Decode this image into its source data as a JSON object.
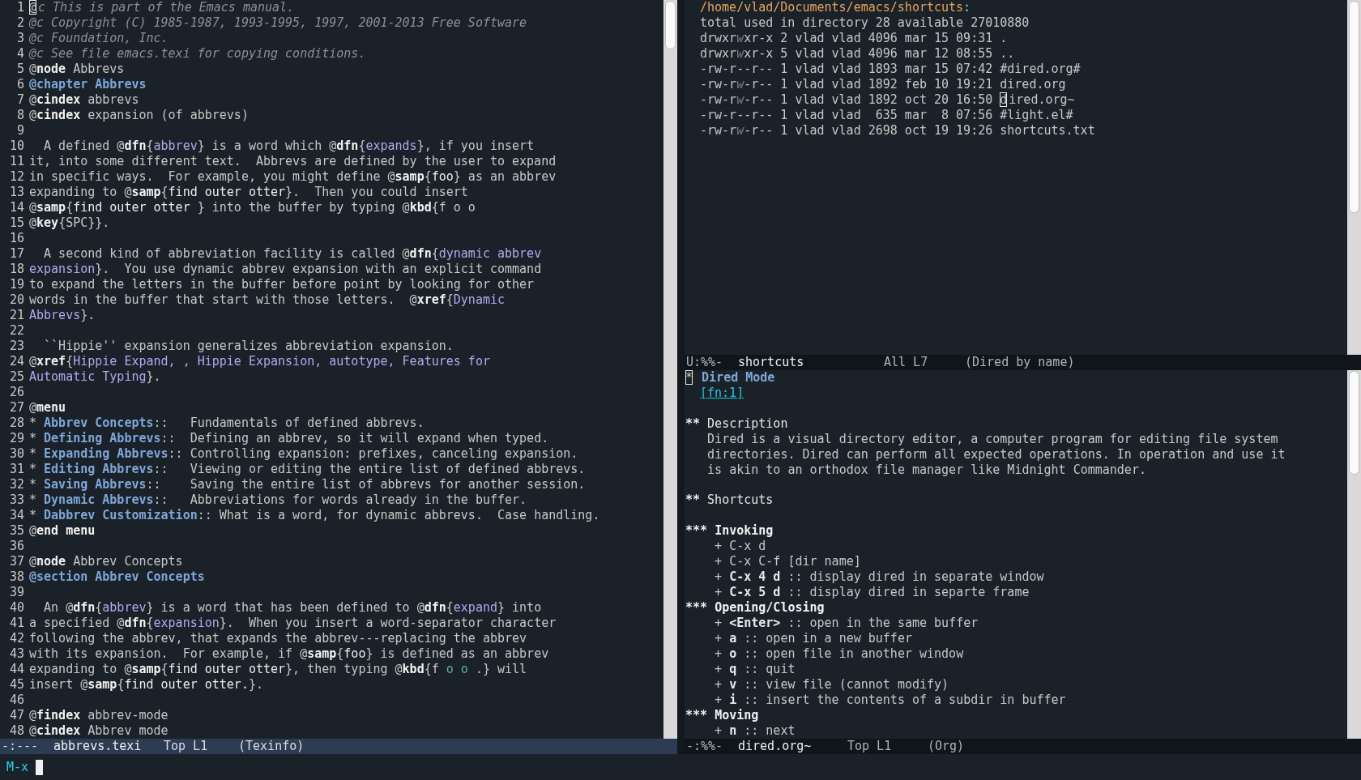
{
  "texinfo_window": {
    "lines": [
      {
        "number": "1",
        "segments": [
          {
            "text": "@",
            "kind": "cursor"
          },
          {
            "text": "c This is part of the Emacs manual.",
            "kind": "comment"
          }
        ]
      },
      {
        "number": "2",
        "segments": [
          {
            "text": "@c Copyright (C) 1985-1987, 1993-1995, 1997, 2001-2013 Free Software",
            "kind": "comment"
          }
        ]
      },
      {
        "number": "3",
        "segments": [
          {
            "text": "@c Foundation, Inc.",
            "kind": "comment"
          }
        ]
      },
      {
        "number": "4",
        "segments": [
          {
            "text": "@c See file emacs.texi for copying conditions.",
            "kind": "comment"
          }
        ]
      },
      {
        "number": "5",
        "segments": [
          {
            "text": "@",
            "kind": "text"
          },
          {
            "text": "node",
            "kind": "command"
          },
          {
            "text": " Abbrevs",
            "kind": "text"
          }
        ]
      },
      {
        "number": "6",
        "segments": [
          {
            "text": "@chapter Abbrevs",
            "kind": "heading"
          }
        ]
      },
      {
        "number": "7",
        "segments": [
          {
            "text": "@",
            "kind": "text"
          },
          {
            "text": "cindex",
            "kind": "command"
          },
          {
            "text": " abbrevs",
            "kind": "text"
          }
        ]
      },
      {
        "number": "8",
        "segments": [
          {
            "text": "@",
            "kind": "text"
          },
          {
            "text": "cindex",
            "kind": "command"
          },
          {
            "text": " expansion (of abbrevs)",
            "kind": "text"
          }
        ]
      },
      {
        "number": "9",
        "kind": "blank"
      },
      {
        "number": "10",
        "segments": [
          {
            "text": "  A defined @",
            "kind": "text"
          },
          {
            "text": "dfn",
            "kind": "command"
          },
          {
            "text": "{",
            "kind": "text"
          },
          {
            "text": "abbrev",
            "kind": "arg"
          },
          {
            "text": "} is a word which @",
            "kind": "text"
          },
          {
            "text": "dfn",
            "kind": "command"
          },
          {
            "text": "{",
            "kind": "text"
          },
          {
            "text": "expands",
            "kind": "arg"
          },
          {
            "text": "}, if you insert",
            "kind": "text"
          }
        ]
      },
      {
        "number": "11",
        "segments": [
          {
            "text": "it, into some different text.  Abbrevs are defined by the user to expand",
            "kind": "text"
          }
        ]
      },
      {
        "number": "12",
        "segments": [
          {
            "text": "in specific ways.  For example, you might define @",
            "kind": "text"
          },
          {
            "text": "samp",
            "kind": "command"
          },
          {
            "text": "{",
            "kind": "text"
          },
          {
            "text": "foo",
            "kind": "literal"
          },
          {
            "text": "} as an abbrev",
            "kind": "text"
          }
        ]
      },
      {
        "number": "13",
        "segments": [
          {
            "text": "expanding to @",
            "kind": "text"
          },
          {
            "text": "samp",
            "kind": "command"
          },
          {
            "text": "{",
            "kind": "text"
          },
          {
            "text": "find outer otter",
            "kind": "literal"
          },
          {
            "text": "}.  Then you could insert",
            "kind": "text"
          }
        ]
      },
      {
        "number": "14",
        "segments": [
          {
            "text": "@",
            "kind": "text"
          },
          {
            "text": "samp",
            "kind": "command"
          },
          {
            "text": "{",
            "kind": "text"
          },
          {
            "text": "find outer otter ",
            "kind": "literal"
          },
          {
            "text": "} into the buffer by typing @",
            "kind": "text"
          },
          {
            "text": "kbd",
            "kind": "command"
          },
          {
            "text": "{f o o",
            "kind": "text"
          }
        ]
      },
      {
        "number": "15",
        "segments": [
          {
            "text": "@",
            "kind": "text"
          },
          {
            "text": "key",
            "kind": "command"
          },
          {
            "text": "{SPC}}.",
            "kind": "text"
          }
        ]
      },
      {
        "number": "16",
        "kind": "blank"
      },
      {
        "number": "17",
        "segments": [
          {
            "text": "  A second kind of abbreviation facility is called @",
            "kind": "text"
          },
          {
            "text": "dfn",
            "kind": "command"
          },
          {
            "text": "{",
            "kind": "text"
          },
          {
            "text": "dynamic abbrev",
            "kind": "arg"
          }
        ]
      },
      {
        "number": "18",
        "segments": [
          {
            "text": "expansion",
            "kind": "arg"
          },
          {
            "text": "}.  You use dynamic abbrev expansion with an explicit command",
            "kind": "text"
          }
        ]
      },
      {
        "number": "19",
        "segments": [
          {
            "text": "to expand the letters in the buffer before point by looking for other",
            "kind": "text"
          }
        ]
      },
      {
        "number": "20",
        "segments": [
          {
            "text": "words in the buffer that start with those letters.  @",
            "kind": "text"
          },
          {
            "text": "xref",
            "kind": "command"
          },
          {
            "text": "{",
            "kind": "text"
          },
          {
            "text": "Dynamic",
            "kind": "arg"
          }
        ]
      },
      {
        "number": "21",
        "segments": [
          {
            "text": "Abbrevs",
            "kind": "arg"
          },
          {
            "text": "}.",
            "kind": "text"
          }
        ]
      },
      {
        "number": "22",
        "kind": "blank"
      },
      {
        "number": "23",
        "segments": [
          {
            "text": "  ``Hippie'' expansion generalizes abbreviation expansion.",
            "kind": "text"
          }
        ]
      },
      {
        "number": "24",
        "segments": [
          {
            "text": "@",
            "kind": "text"
          },
          {
            "text": "xref",
            "kind": "command"
          },
          {
            "text": "{",
            "kind": "text"
          },
          {
            "text": "Hippie Expand, , Hippie Expansion, autotype, Features for",
            "kind": "arg"
          }
        ]
      },
      {
        "number": "25",
        "segments": [
          {
            "text": "Automatic Typing",
            "kind": "arg"
          },
          {
            "text": "}.",
            "kind": "text"
          }
        ]
      },
      {
        "number": "26",
        "kind": "blank"
      },
      {
        "number": "27",
        "segments": [
          {
            "text": "@",
            "kind": "text"
          },
          {
            "text": "menu",
            "kind": "command"
          }
        ]
      },
      {
        "number": "28",
        "segments": [
          {
            "text": "* ",
            "kind": "text"
          },
          {
            "text": "Abbrev Concepts",
            "kind": "heading"
          },
          {
            "text": "::   Fundamentals of defined abbrevs.",
            "kind": "text"
          }
        ]
      },
      {
        "number": "29",
        "segments": [
          {
            "text": "* ",
            "kind": "text"
          },
          {
            "text": "Defining Abbrevs",
            "kind": "heading"
          },
          {
            "text": "::  Defining an abbrev, so it will expand when typed.",
            "kind": "text"
          }
        ]
      },
      {
        "number": "30",
        "segments": [
          {
            "text": "* ",
            "kind": "text"
          },
          {
            "text": "Expanding Abbrevs",
            "kind": "heading"
          },
          {
            "text": ":: Controlling expansion: prefixes, canceling expansion.",
            "kind": "text"
          }
        ]
      },
      {
        "number": "31",
        "segments": [
          {
            "text": "* ",
            "kind": "text"
          },
          {
            "text": "Editing Abbrevs",
            "kind": "heading"
          },
          {
            "text": "::   Viewing or editing the entire list of defined abbrevs.",
            "kind": "text"
          }
        ]
      },
      {
        "number": "32",
        "segments": [
          {
            "text": "* ",
            "kind": "text"
          },
          {
            "text": "Saving Abbrevs",
            "kind": "heading"
          },
          {
            "text": "::    Saving the entire list of abbrevs for another session.",
            "kind": "text"
          }
        ]
      },
      {
        "number": "33",
        "segments": [
          {
            "text": "* ",
            "kind": "text"
          },
          {
            "text": "Dynamic Abbrevs",
            "kind": "heading"
          },
          {
            "text": "::   Abbreviations for words already in the buffer.",
            "kind": "text"
          }
        ]
      },
      {
        "number": "34",
        "segments": [
          {
            "text": "* ",
            "kind": "text"
          },
          {
            "text": "Dabbrev Customization",
            "kind": "heading"
          },
          {
            "text": ":: What is a word, for dynamic abbrevs.  Case handling.",
            "kind": "text"
          }
        ]
      },
      {
        "number": "35",
        "segments": [
          {
            "text": "@",
            "kind": "text"
          },
          {
            "text": "end menu",
            "kind": "command"
          }
        ]
      },
      {
        "number": "36",
        "kind": "blank"
      },
      {
        "number": "37",
        "segments": [
          {
            "text": "@",
            "kind": "text"
          },
          {
            "text": "node",
            "kind": "command"
          },
          {
            "text": " Abbrev Concepts",
            "kind": "text"
          }
        ]
      },
      {
        "number": "38",
        "segments": [
          {
            "text": "@section Abbrev Concepts",
            "kind": "heading"
          }
        ]
      },
      {
        "number": "39",
        "kind": "blank"
      },
      {
        "number": "40",
        "segments": [
          {
            "text": "  An @",
            "kind": "text"
          },
          {
            "text": "dfn",
            "kind": "command"
          },
          {
            "text": "{",
            "kind": "text"
          },
          {
            "text": "abbrev",
            "kind": "arg"
          },
          {
            "text": "} is a word that has been defined to @",
            "kind": "text"
          },
          {
            "text": "dfn",
            "kind": "command"
          },
          {
            "text": "{",
            "kind": "text"
          },
          {
            "text": "expand",
            "kind": "arg"
          },
          {
            "text": "} into",
            "kind": "text"
          }
        ]
      },
      {
        "number": "41",
        "segments": [
          {
            "text": "a specified @",
            "kind": "text"
          },
          {
            "text": "dfn",
            "kind": "command"
          },
          {
            "text": "{",
            "kind": "text"
          },
          {
            "text": "expansion",
            "kind": "arg"
          },
          {
            "text": "}.  When you insert a word-separator character",
            "kind": "text"
          }
        ]
      },
      {
        "number": "42",
        "segments": [
          {
            "text": "following the abbrev, that expands the abbrev---replacing the abbrev",
            "kind": "text"
          }
        ]
      },
      {
        "number": "43",
        "segments": [
          {
            "text": "with its expansion.  For example, if @",
            "kind": "text"
          },
          {
            "text": "samp",
            "kind": "command"
          },
          {
            "text": "{",
            "kind": "text"
          },
          {
            "text": "foo",
            "kind": "literal"
          },
          {
            "text": "} is defined as an abbrev",
            "kind": "text"
          }
        ]
      },
      {
        "number": "44",
        "segments": [
          {
            "text": "expanding to @",
            "kind": "text"
          },
          {
            "text": "samp",
            "kind": "command"
          },
          {
            "text": "{",
            "kind": "text"
          },
          {
            "text": "find outer otter",
            "kind": "literal"
          },
          {
            "text": "}, then typing @",
            "kind": "text"
          },
          {
            "text": "kbd",
            "kind": "command"
          },
          {
            "text": "{f ",
            "kind": "text"
          },
          {
            "text": "o o",
            "kind": "keychar"
          },
          {
            "text": " .} will",
            "kind": "text"
          }
        ]
      },
      {
        "number": "45",
        "segments": [
          {
            "text": "insert @",
            "kind": "text"
          },
          {
            "text": "samp",
            "kind": "command"
          },
          {
            "text": "{",
            "kind": "text"
          },
          {
            "text": "find outer otter.",
            "kind": "literal"
          },
          {
            "text": "}.",
            "kind": "text"
          }
        ]
      },
      {
        "number": "46",
        "kind": "blank"
      },
      {
        "number": "47",
        "segments": [
          {
            "text": "@",
            "kind": "text"
          },
          {
            "text": "findex",
            "kind": "command"
          },
          {
            "text": " abbrev-mode",
            "kind": "text"
          }
        ]
      },
      {
        "number": "48",
        "segments": [
          {
            "text": "@",
            "kind": "text"
          },
          {
            "text": "cindex",
            "kind": "command"
          },
          {
            "text": " Abbrev mode",
            "kind": "text"
          }
        ]
      }
    ],
    "mode_line": {
      "status": "-:---",
      "buffer": "abbrevs.texi",
      "position": "Top L1",
      "mode": "(Texinfo)",
      "active": true
    }
  },
  "dired_window": {
    "lines": [
      {
        "segments": [
          {
            "text": "/home/vlad/Documents/emacs/shortcuts",
            "kind": "path"
          },
          {
            "text": ":",
            "kind": "text"
          }
        ]
      },
      {
        "segments": [
          {
            "text": "total used in directory 28 available 27010880",
            "kind": "text"
          }
        ]
      },
      {
        "segments": [
          {
            "text": "drwxr",
            "kind": "text"
          },
          {
            "text": "w",
            "kind": "perm-dim"
          },
          {
            "text": "xr-x 2 vlad vlad 4096 mar 15 09:31 .",
            "kind": "text"
          }
        ]
      },
      {
        "segments": [
          {
            "text": "drwxr",
            "kind": "text"
          },
          {
            "text": "w",
            "kind": "perm-dim"
          },
          {
            "text": "xr-x 5 vlad vlad 4096 mar 12 08:55 ..",
            "kind": "text"
          }
        ]
      },
      {
        "segments": [
          {
            "text": "-rw-r--r-- 1 vlad vlad 1893 mar 15 07:42 #dired.org#",
            "kind": "text"
          }
        ]
      },
      {
        "segments": [
          {
            "text": "-rw-r",
            "kind": "text"
          },
          {
            "text": "w",
            "kind": "perm-dim"
          },
          {
            "text": "-r-- 1 vlad vlad 1892 feb 10 19:21 dired.org",
            "kind": "text"
          }
        ]
      },
      {
        "segments": [
          {
            "text": "-rw-r",
            "kind": "text"
          },
          {
            "text": "w",
            "kind": "perm-dim"
          },
          {
            "text": "-r-- 1 vlad vlad 1892 oct 20 16:50 ",
            "kind": "text"
          },
          {
            "text": "d",
            "kind": "cursor"
          },
          {
            "text": "ired.org~",
            "kind": "text"
          }
        ]
      },
      {
        "segments": [
          {
            "text": "-rw-r--r-- 1 vlad vlad  635 mar  8 07:56 #light.el#",
            "kind": "text"
          }
        ]
      },
      {
        "segments": [
          {
            "text": "-rw-r",
            "kind": "text"
          },
          {
            "text": "w",
            "kind": "perm-dim"
          },
          {
            "text": "-r-- 1 vlad vlad 2698 oct 19 19:26 shortcuts.txt",
            "kind": "text"
          }
        ]
      }
    ],
    "mode_line": {
      "status": "U:%%-",
      "buffer": "shortcuts",
      "position": "All L7",
      "mode": "(Dired by name)",
      "active": false
    }
  },
  "org_window": {
    "lines": [
      {
        "segments": [
          {
            "text": "*",
            "kind": "cursor"
          },
          {
            "text": " Dired Mode",
            "kind": "org-h1"
          }
        ]
      },
      {
        "segments": [
          {
            "text": "[fn:1]",
            "kind": "footnote"
          }
        ]
      },
      {
        "kind": "blank"
      },
      {
        "segments": [
          {
            "text": "** ",
            "kind": "star"
          },
          {
            "text": "Description",
            "kind": "org-h2"
          }
        ]
      },
      {
        "segments": [
          {
            "text": "   Dired is a visual directory editor, a computer program for editing file system",
            "kind": "text"
          }
        ]
      },
      {
        "segments": [
          {
            "text": "   directories. Dired can perform all expected operations. In operation and use it",
            "kind": "text"
          }
        ]
      },
      {
        "segments": [
          {
            "text": "   is akin to an orthodox file manager like Midnight Commander.",
            "kind": "text"
          }
        ]
      },
      {
        "kind": "blank"
      },
      {
        "segments": [
          {
            "text": "** ",
            "kind": "star"
          },
          {
            "text": "Shortcuts",
            "kind": "org-h2"
          }
        ]
      },
      {
        "kind": "blank"
      },
      {
        "segments": [
          {
            "text": "*** ",
            "kind": "star"
          },
          {
            "text": "Invoking",
            "kind": "org-h3"
          }
        ]
      },
      {
        "segments": [
          {
            "text": "    + C-x d",
            "kind": "text"
          }
        ]
      },
      {
        "segments": [
          {
            "text": "    + C-x C-f [dir name]",
            "kind": "text"
          }
        ]
      },
      {
        "segments": [
          {
            "text": "    + ",
            "kind": "text"
          },
          {
            "text": "C-x 4 d",
            "kind": "key"
          },
          {
            "text": " :: display dired in separate window",
            "kind": "text"
          }
        ]
      },
      {
        "segments": [
          {
            "text": "    + ",
            "kind": "text"
          },
          {
            "text": "C-x 5 d",
            "kind": "key"
          },
          {
            "text": " :: display dired in separte frame",
            "kind": "text"
          }
        ]
      },
      {
        "segments": [
          {
            "text": "*** ",
            "kind": "star"
          },
          {
            "text": "Opening/Closing",
            "kind": "org-h3"
          }
        ]
      },
      {
        "segments": [
          {
            "text": "    + ",
            "kind": "text"
          },
          {
            "text": "<Enter>",
            "kind": "key"
          },
          {
            "text": " :: open in the same buffer",
            "kind": "text"
          }
        ]
      },
      {
        "segments": [
          {
            "text": "    + ",
            "kind": "text"
          },
          {
            "text": "a",
            "kind": "key"
          },
          {
            "text": " :: open in a new buffer",
            "kind": "text"
          }
        ]
      },
      {
        "segments": [
          {
            "text": "    + ",
            "kind": "text"
          },
          {
            "text": "o",
            "kind": "key"
          },
          {
            "text": " :: open file in another window",
            "kind": "text"
          }
        ]
      },
      {
        "segments": [
          {
            "text": "    + ",
            "kind": "text"
          },
          {
            "text": "q",
            "kind": "key"
          },
          {
            "text": " :: quit",
            "kind": "text"
          }
        ]
      },
      {
        "segments": [
          {
            "text": "    + ",
            "kind": "text"
          },
          {
            "text": "v",
            "kind": "key"
          },
          {
            "text": " :: view file (cannot modify)",
            "kind": "text"
          }
        ]
      },
      {
        "segments": [
          {
            "text": "    + ",
            "kind": "text"
          },
          {
            "text": "i",
            "kind": "key"
          },
          {
            "text": " :: insert the contents of a subdir in buffer",
            "kind": "text"
          }
        ]
      },
      {
        "segments": [
          {
            "text": "*** ",
            "kind": "star"
          },
          {
            "text": "Moving",
            "kind": "org-h3"
          }
        ]
      },
      {
        "segments": [
          {
            "text": "    + ",
            "kind": "text"
          },
          {
            "text": "n",
            "kind": "key"
          },
          {
            "text": " :: next",
            "kind": "text"
          }
        ]
      }
    ],
    "mode_line": {
      "status": "-:%%-",
      "buffer": "dired.org~",
      "position": "Top L1",
      "mode": "(Org)",
      "active": false
    }
  },
  "minibuffer": {
    "prompt": "M-x"
  }
}
